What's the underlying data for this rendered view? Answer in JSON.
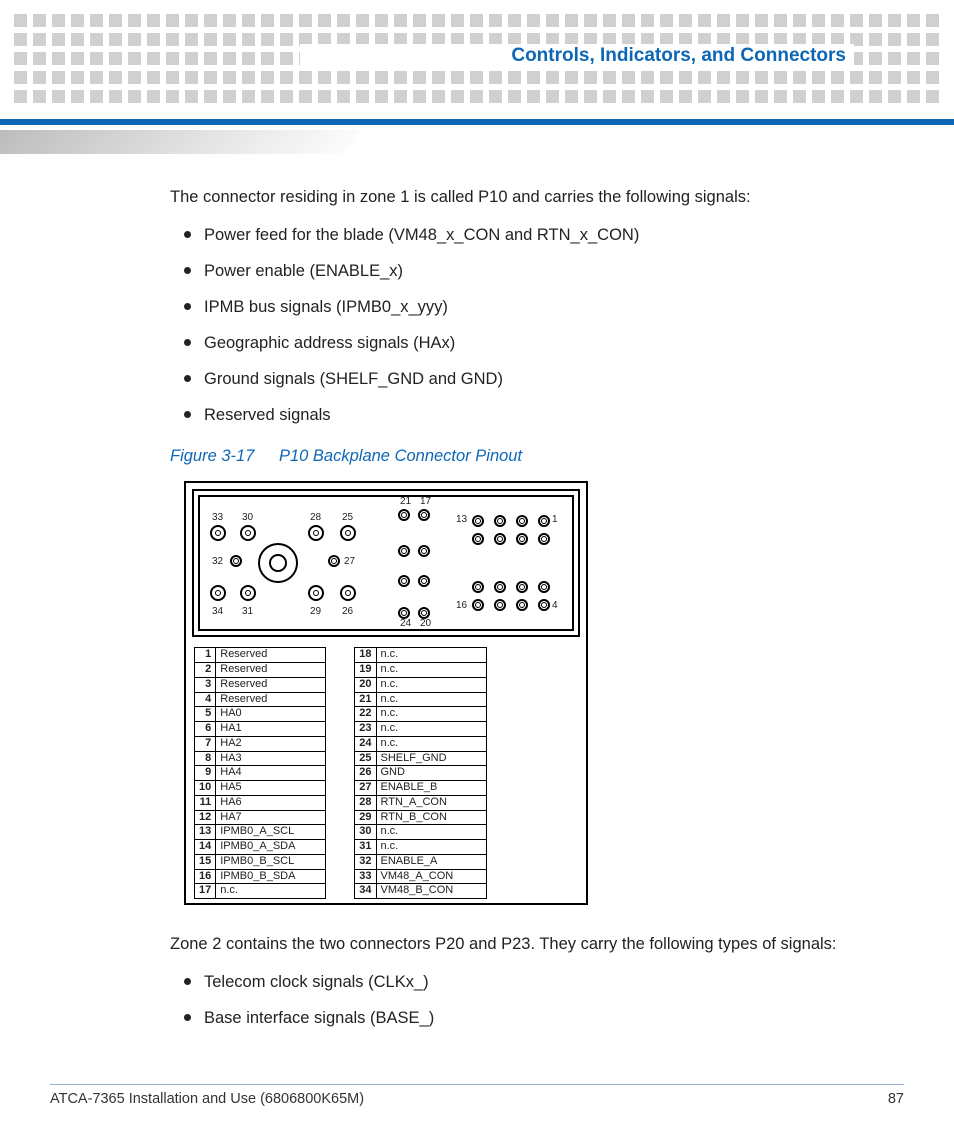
{
  "header": {
    "chapter_title": "Controls, Indicators, and Connectors"
  },
  "intro": "The connector residing in zone 1 is called P10 and carries the following signals:",
  "signals_zone1": [
    "Power feed for the blade (VM48_x_CON and RTN_x_CON)",
    "Power enable (ENABLE_x)",
    "IPMB bus signals (IPMB0_x_yyy)",
    "Geographic address signals (HAx)",
    "Ground signals (SHELF_GND and GND)",
    "Reserved signals"
  ],
  "figure": {
    "number": "Figure 3-17",
    "title": "P10 Backplane Connector Pinout"
  },
  "diagram_labels": {
    "33": "33",
    "30": "30",
    "28": "28",
    "25": "25",
    "21": "21",
    "17": "17",
    "13": "13",
    "1": "1",
    "32": "32",
    "27": "27",
    "34": "34",
    "31": "31",
    "29": "29",
    "26": "26",
    "24": "24",
    "20": "20",
    "16": "16",
    "4": "4"
  },
  "pinout_left": [
    {
      "n": "1",
      "s": "Reserved"
    },
    {
      "n": "2",
      "s": "Reserved"
    },
    {
      "n": "3",
      "s": "Reserved"
    },
    {
      "n": "4",
      "s": "Reserved"
    },
    {
      "n": "5",
      "s": "HA0"
    },
    {
      "n": "6",
      "s": "HA1"
    },
    {
      "n": "7",
      "s": "HA2"
    },
    {
      "n": "8",
      "s": "HA3"
    },
    {
      "n": "9",
      "s": "HA4"
    },
    {
      "n": "10",
      "s": "HA5"
    },
    {
      "n": "11",
      "s": "HA6"
    },
    {
      "n": "12",
      "s": "HA7"
    },
    {
      "n": "13",
      "s": "IPMB0_A_SCL"
    },
    {
      "n": "14",
      "s": "IPMB0_A_SDA"
    },
    {
      "n": "15",
      "s": "IPMB0_B_SCL"
    },
    {
      "n": "16",
      "s": "IPMB0_B_SDA"
    },
    {
      "n": "17",
      "s": "n.c."
    }
  ],
  "pinout_right": [
    {
      "n": "18",
      "s": "n.c."
    },
    {
      "n": "19",
      "s": "n.c."
    },
    {
      "n": "20",
      "s": "n.c."
    },
    {
      "n": "21",
      "s": "n.c."
    },
    {
      "n": "22",
      "s": "n.c."
    },
    {
      "n": "23",
      "s": "n.c."
    },
    {
      "n": "24",
      "s": "n.c."
    },
    {
      "n": "25",
      "s": "SHELF_GND"
    },
    {
      "n": "26",
      "s": "GND"
    },
    {
      "n": "27",
      "s": "ENABLE_B"
    },
    {
      "n": "28",
      "s": "RTN_A_CON"
    },
    {
      "n": "29",
      "s": "RTN_B_CON"
    },
    {
      "n": "30",
      "s": "n.c."
    },
    {
      "n": "31",
      "s": "n.c."
    },
    {
      "n": "32",
      "s": "ENABLE_A"
    },
    {
      "n": "33",
      "s": "VM48_A_CON"
    },
    {
      "n": "34",
      "s": "VM48_B_CON"
    }
  ],
  "zone2_intro": "Zone 2 contains the two connectors P20 and P23. They carry the following types of signals:",
  "signals_zone2": [
    "Telecom clock signals (CLKx_)",
    "Base interface signals (BASE_)"
  ],
  "footer": {
    "doc": "ATCA-7365 Installation and Use (6806800K65M)",
    "page": "87"
  }
}
